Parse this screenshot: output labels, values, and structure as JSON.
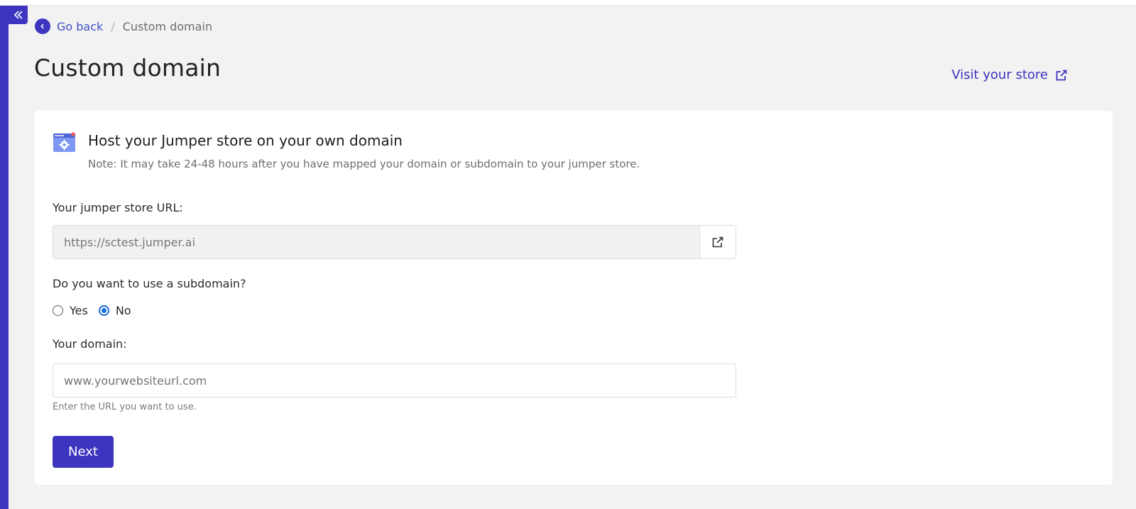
{
  "breadcrumb": {
    "back_label": "Go back",
    "separator": "/",
    "current": "Custom domain"
  },
  "page": {
    "title": "Custom domain",
    "visit_store_label": "Visit your store"
  },
  "card": {
    "heading": "Host your Jumper store on your own domain",
    "note": "Note: It may take 24-48 hours after you have mapped your domain or subdomain to your jumper store."
  },
  "store_url": {
    "label": "Your jumper store URL:",
    "value": "https://sctest.jumper.ai"
  },
  "subdomain": {
    "question": "Do you want to use a subdomain?",
    "options": [
      {
        "label": "Yes",
        "selected": false
      },
      {
        "label": "No",
        "selected": true
      }
    ]
  },
  "domain": {
    "label": "Your domain:",
    "placeholder": "www.yourwebsiteurl.com",
    "help": "Enter the URL you want to use."
  },
  "actions": {
    "next_label": "Next"
  },
  "colors": {
    "accent": "#3d35c0",
    "link": "#3d50c8",
    "radio_checked": "#1a6fe0",
    "background": "#f2f2f2"
  },
  "icons": {
    "collapse": "double-chevron-left-icon",
    "back": "chevron-left-icon",
    "external": "external-link-icon",
    "card": "browser-settings-icon"
  }
}
